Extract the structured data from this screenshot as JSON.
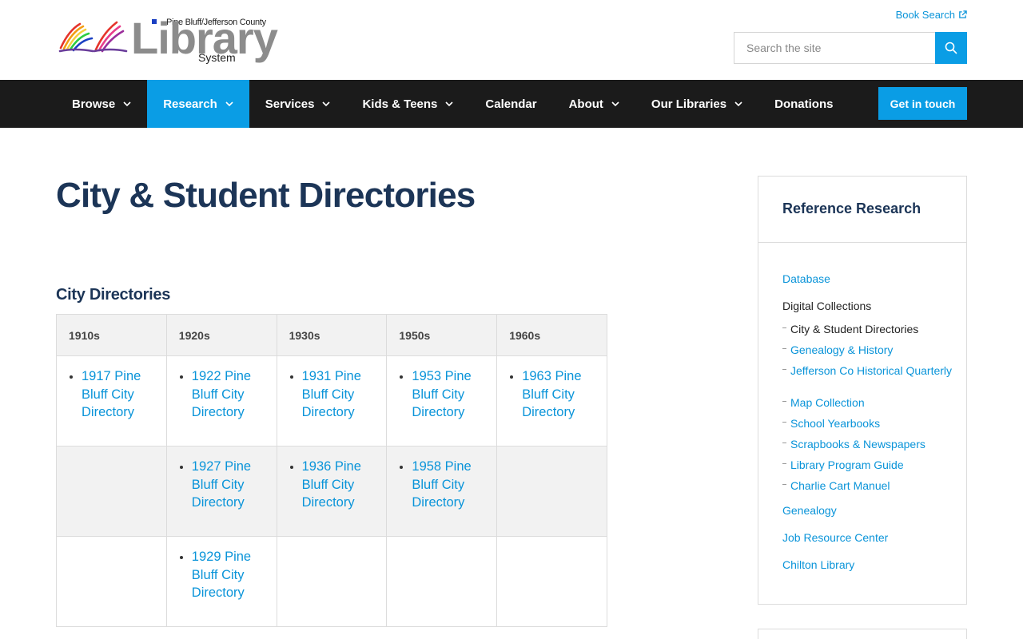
{
  "header": {
    "logo": {
      "top_text": "Pine Bluff/Jefferson County",
      "word": "Library",
      "sub_text": "System"
    },
    "book_search_label": "Book Search",
    "search_placeholder": "Search the site"
  },
  "nav": {
    "items": [
      {
        "label": "Browse",
        "dropdown": true
      },
      {
        "label": "Research",
        "dropdown": true,
        "active": true
      },
      {
        "label": "Services",
        "dropdown": true
      },
      {
        "label": "Kids & Teens",
        "dropdown": true
      },
      {
        "label": "Calendar",
        "dropdown": false
      },
      {
        "label": "About",
        "dropdown": true
      },
      {
        "label": "Our Libraries",
        "dropdown": true
      },
      {
        "label": "Donations",
        "dropdown": false
      }
    ],
    "cta_label": "Get in touch"
  },
  "main": {
    "title": "City & Student Directories",
    "section_title": "City Directories",
    "table": {
      "headers": [
        "1910s",
        "1920s",
        "1930s",
        "1950s",
        "1960s"
      ],
      "rows": [
        [
          "1917 Pine Bluff City Directory",
          "1922 Pine Bluff City Directory",
          "1931 Pine Bluff City Directory",
          "1953 Pine Bluff City Directory",
          "1963 Pine Bluff City Directory"
        ],
        [
          "",
          "1927 Pine Bluff City Directory",
          "1936 Pine Bluff City Directory",
          "1958 Pine Bluff City Directory",
          ""
        ],
        [
          "",
          "1929 Pine Bluff City Directory",
          "",
          "",
          ""
        ]
      ]
    }
  },
  "sidebar": {
    "title": "Reference Research",
    "items": [
      {
        "label": "Database"
      },
      {
        "label": "Digital Collections"
      },
      {
        "label": "Genealogy"
      },
      {
        "label": "Job Resource Center"
      },
      {
        "label": "Chilton Library"
      }
    ],
    "sub_items": [
      {
        "label": "City & Student Directories",
        "current": true
      },
      {
        "label": "Genealogy & History"
      },
      {
        "label": "Jefferson Co Historical Quarterly"
      },
      {
        "label": "Map Collection"
      },
      {
        "label": "School Yearbooks"
      },
      {
        "label": "Scrapbooks & Newspapers"
      },
      {
        "label": "Library Program Guide"
      },
      {
        "label": "Charlie Cart Manuel"
      }
    ]
  },
  "colors": {
    "accent": "#0a9de5",
    "nav_bg": "#1b1b1b",
    "heading": "#1c3557",
    "link": "#0a94d9"
  }
}
